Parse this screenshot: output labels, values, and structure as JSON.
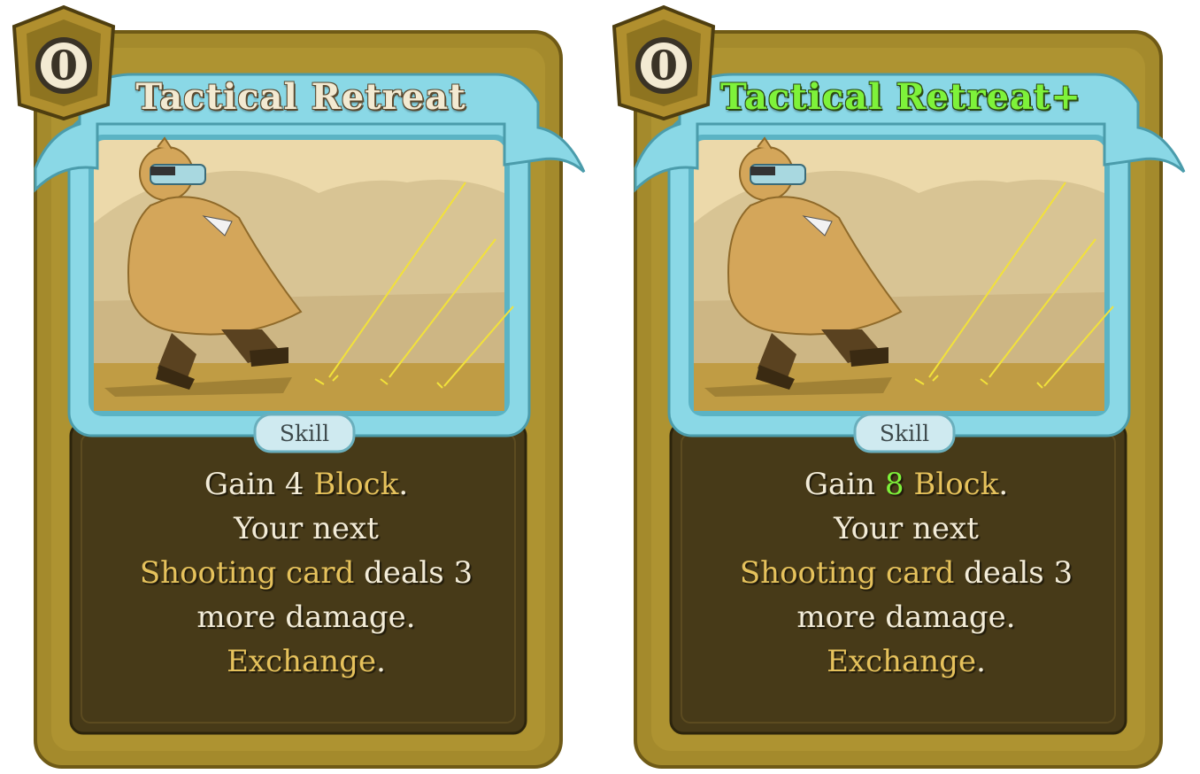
{
  "colors": {
    "frame_gold": "#a48a2c",
    "panel_dark": "#473a18",
    "banner_cyan": "#8ad8e6",
    "keyword": "#e6c25c",
    "upgraded_green": "#7ef23a"
  },
  "cards": [
    {
      "cost": "0",
      "title": "Tactical Retreat",
      "type": "Skill",
      "desc": {
        "l1_a": "Gain 4 ",
        "l1_kw": "Block",
        "l1_b": ".",
        "l2": "Your next",
        "l3_kw": "Shooting card",
        "l3_b": " deals 3",
        "l4": "more damage.",
        "l5_kw": "Exchange",
        "l5_b": "."
      }
    },
    {
      "cost": "0",
      "title": "Tactical Retreat+",
      "type": "Skill",
      "desc": {
        "l1_a": "Gain ",
        "l1_num": "8",
        "l1_sp": " ",
        "l1_kw": "Block",
        "l1_b": ".",
        "l2": "Your next",
        "l3_kw": "Shooting card",
        "l3_b": " deals 3",
        "l4": "more damage.",
        "l5_kw": "Exchange",
        "l5_b": "."
      }
    }
  ]
}
